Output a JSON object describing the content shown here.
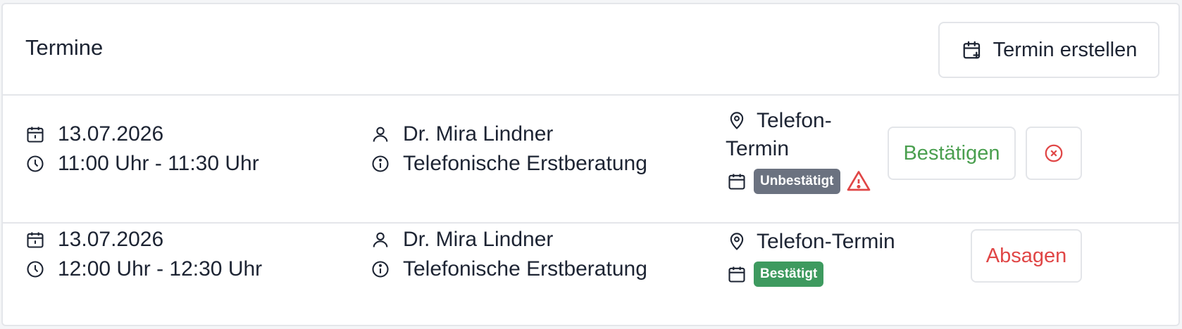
{
  "header": {
    "title": "Termine",
    "create_label": "Termin erstellen"
  },
  "appointments": [
    {
      "date": "13.07.2026",
      "time": "11:00 Uhr - 11:30 Uhr",
      "person": "Dr. Mira Lindner",
      "type": "Telefonische Erstberatung",
      "location_line1": "Telefon-",
      "location_line2": "Termin",
      "status": "Unbestätigt",
      "status_color": "#6b7280",
      "action_label": "Bestätigen",
      "action_color": "#4a9f4f",
      "secondary_icon": "x-circle-icon",
      "warning_icon": "warning-triangle-icon"
    },
    {
      "date": "13.07.2026",
      "time": "12:00 Uhr - 12:30 Uhr",
      "person": "Dr. Mira Lindner",
      "type": "Telefonische Erstberatung",
      "location": "Telefon-Termin",
      "status": "Bestätigt",
      "status_color": "#3e9a5f",
      "action_label": "Absagen",
      "action_color": "#e04646"
    }
  ],
  "icons": [
    "calendar-plus-icon",
    "calendar-icon",
    "clock-icon",
    "user-icon",
    "info-icon",
    "map-pin-icon",
    "x-circle-icon",
    "warning-triangle-icon"
  ]
}
